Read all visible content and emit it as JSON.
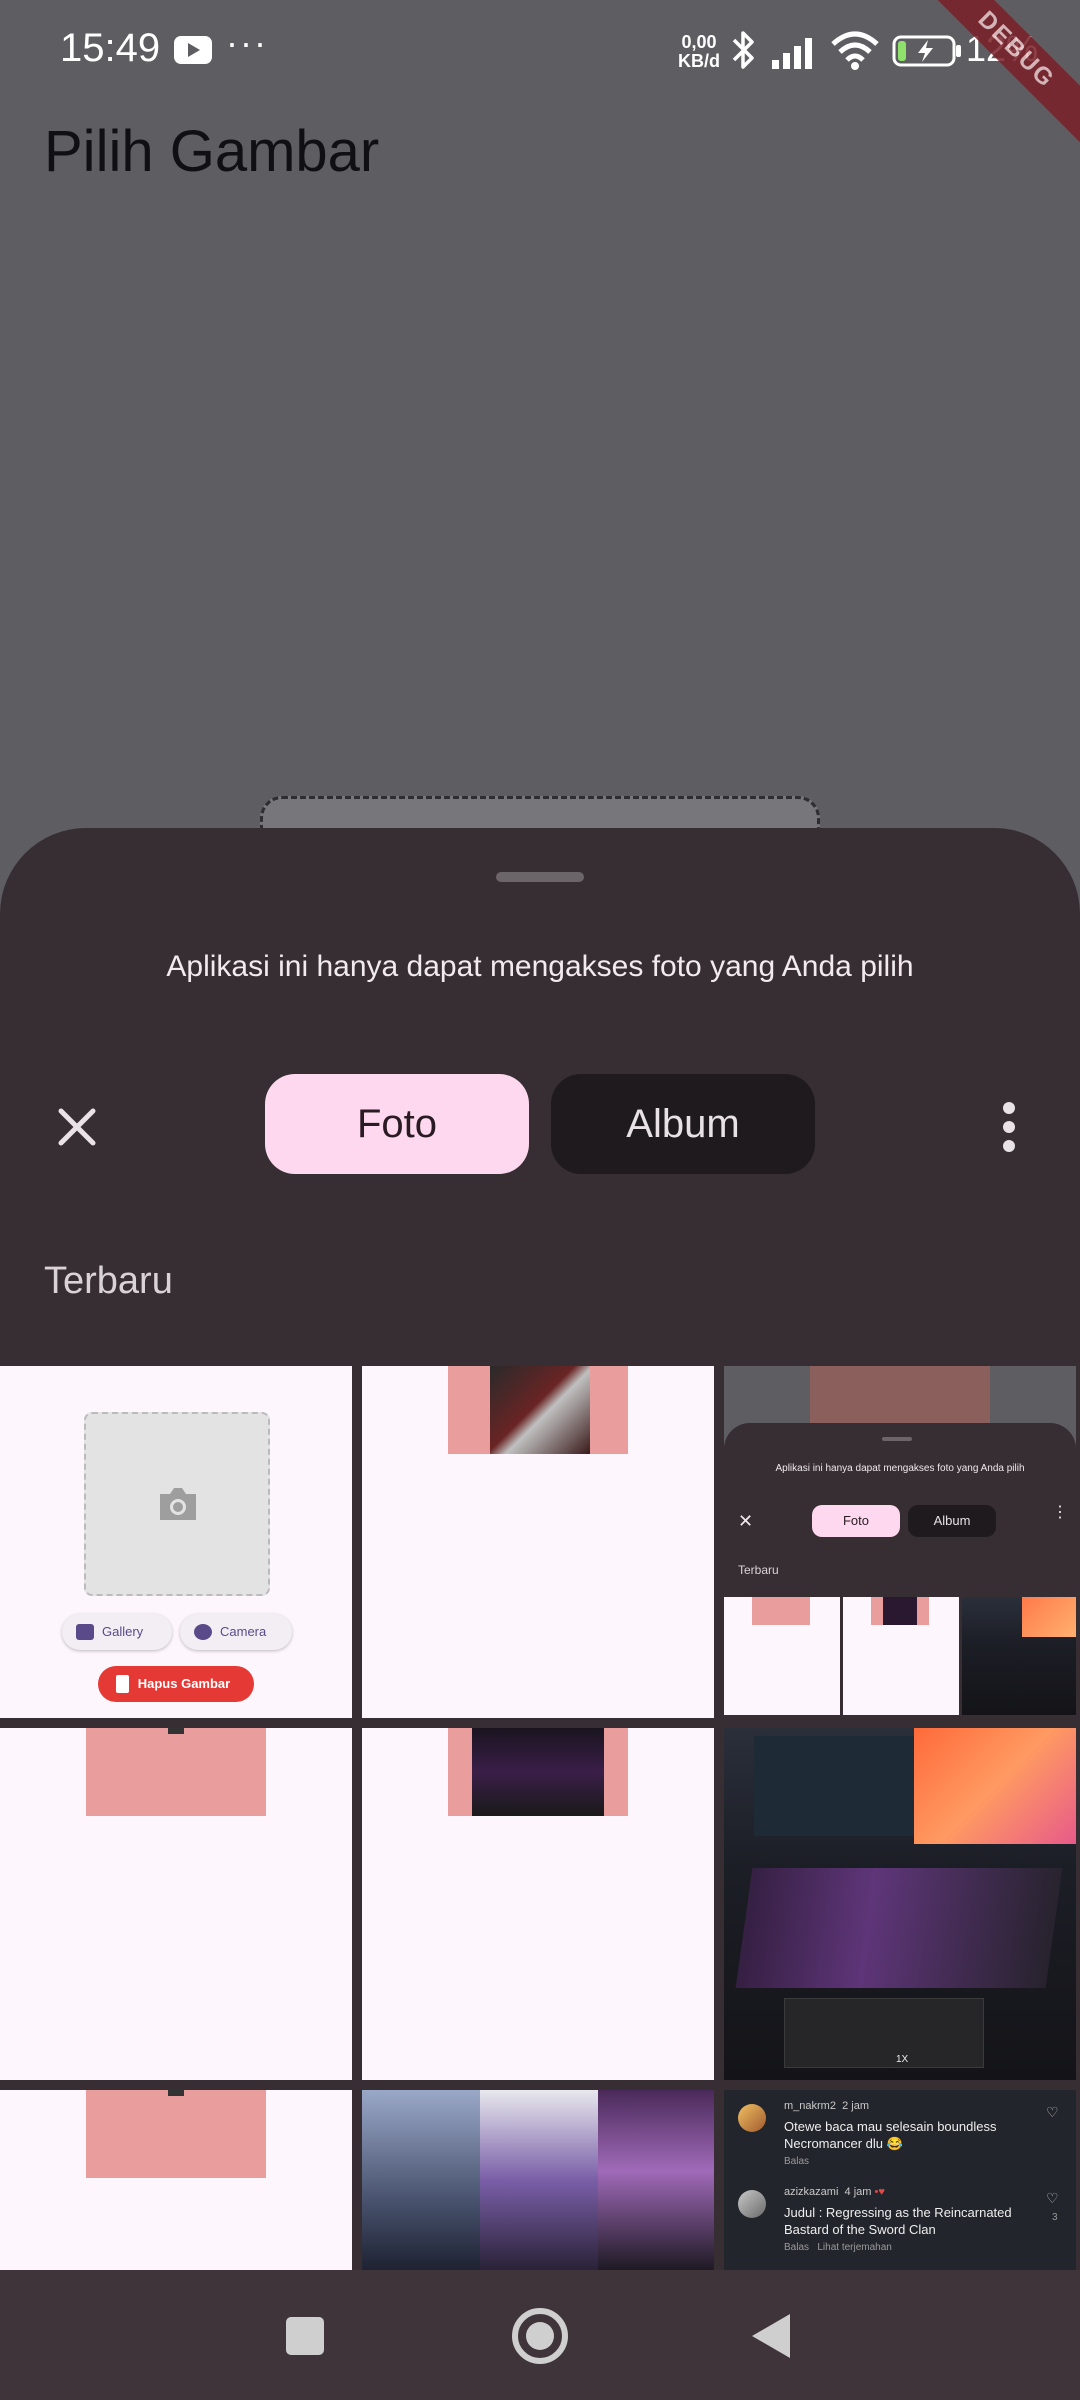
{
  "status": {
    "time": "15:49",
    "speed_value": "0,00",
    "speed_unit": "KB/d",
    "battery": "12%",
    "debug_banner": "DEBUG",
    "icons": [
      "youtube-icon",
      "more-dots-icon",
      "bluetooth-icon",
      "signal-icon",
      "wifi-icon",
      "battery-charging-icon"
    ]
  },
  "app": {
    "title": "Pilih Gambar"
  },
  "sheet": {
    "message": "Aplikasi ini hanya dapat mengakses foto yang Anda pilih",
    "tabs": [
      {
        "label": "Foto",
        "selected": true
      },
      {
        "label": "Album",
        "selected": false
      }
    ],
    "section": "Terbaru",
    "accent_color": "#fdd8ee"
  },
  "thumbs": {
    "picker": {
      "gallery": "Gallery",
      "camera": "Camera",
      "delete": "Hapus Gambar"
    },
    "nested": {
      "message": "Aplikasi ini hanya dapat mengakses foto yang Anda pilih",
      "tab_foto": "Foto",
      "tab_album": "Album",
      "section": "Terbaru"
    },
    "laptop_label": "1X",
    "comments": [
      {
        "user": "m_nakrm2",
        "time": "2 jam",
        "text": "Otewe baca mau selesain boundless Necromancer dlu 😂",
        "reply": "Balas"
      },
      {
        "user": "azizkazami",
        "time": "4 jam",
        "text": "Judul : Regressing as the Reincarnated Bastard of the Sword Clan",
        "reply": "Balas",
        "translate": "Lihat terjemahan",
        "likes": "3"
      }
    ]
  },
  "nav": {
    "icons": [
      "recent-apps-icon",
      "home-icon",
      "back-icon"
    ]
  }
}
